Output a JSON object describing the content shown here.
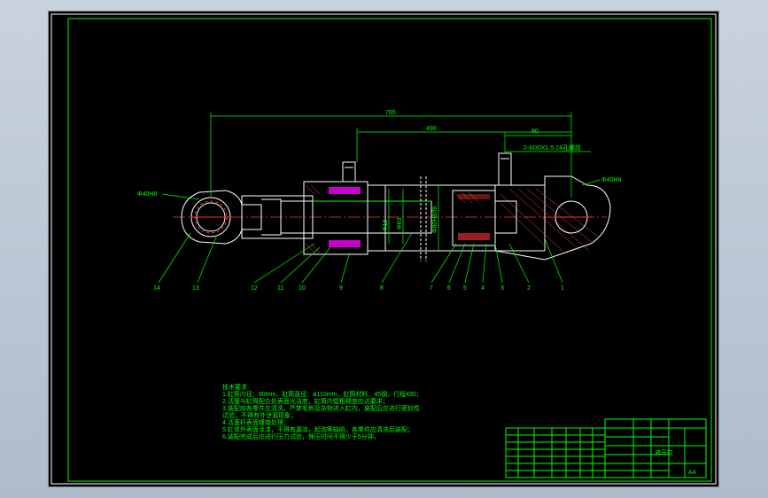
{
  "drawing": {
    "dims": {
      "overall_length": "765",
      "stroke_length": "490",
      "offset": "80",
      "port_thread": "2-M30X1.5 24孔螺纹",
      "left_hole": "Φ40H8",
      "right_hole": "Φ40H8",
      "rod_dia": "Φ16",
      "bore_dia": "Φ63",
      "piston_fit": "Φ80H8/f8"
    },
    "balloons": [
      "14",
      "13",
      "12",
      "11",
      "10",
      "9",
      "8",
      "7",
      "6",
      "5",
      "4",
      "3",
      "2",
      "1"
    ],
    "notes": {
      "title": "技术要求",
      "lines": [
        "1.缸筒内径：90mm，缸筒直径：ø110mm，缸筒材料：45钢，行程490；",
        "2.活塞与缸筒配合处表面光洁度，缸筒内壁粗糙度应达要求；",
        "3.装配前各零件应清洗，严禁毛刺及杂物进入缸内，装配后应进行密封性",
        "试验，不得有外泄漏现象；",
        "4.活塞杆表面镀铬处理；",
        "5.缸体外表面涂漆，不得有漏涂，起泡等缺陷，各零件应清洗后装配；",
        "6.装配完成后应进行压力试验，保压时间不得少于5分钟。"
      ]
    },
    "title_block": {
      "drawing_name": "液压缸",
      "sheet_size": "A4"
    }
  },
  "colors": {
    "background": "#000000",
    "lines": "#00ff00",
    "outline": "#ffffff",
    "centerline": "#ff0000",
    "seals": "#ff00ff"
  }
}
